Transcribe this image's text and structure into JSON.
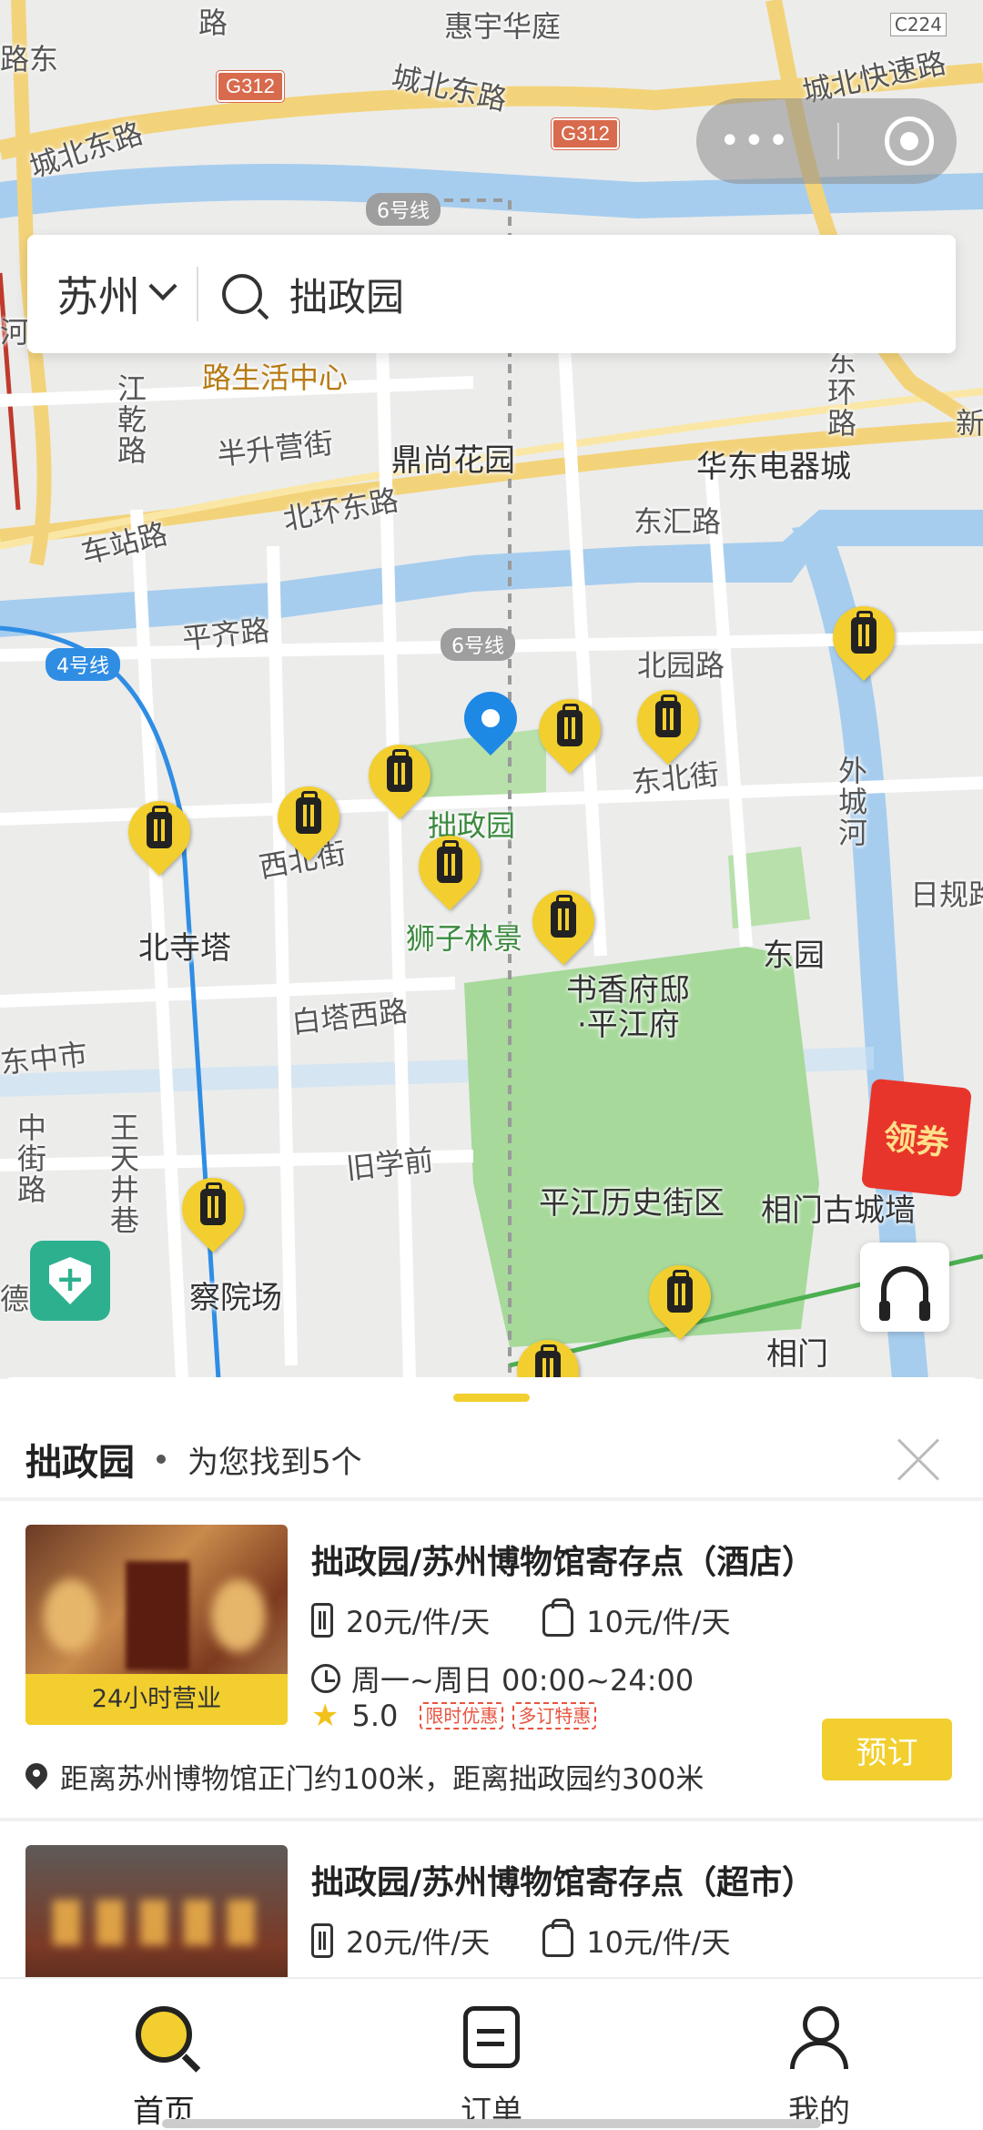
{
  "status_bar": {
    "carrier": "C224"
  },
  "search": {
    "city": "苏州",
    "query": "拙政园"
  },
  "map": {
    "labels": {
      "huiyu": "惠宇华庭",
      "chengbei_dong_1": "城北东路",
      "chengbei_dong_2": "城北东路",
      "chengbei_kuaisu": "城北快速路",
      "lu_shenghuo": "路生活中心",
      "banyuejie": "半升营街",
      "dingshang": "鼎尚花园",
      "beihuandong": "北环东路",
      "huadong": "华东电器城",
      "dongjin": "东汇路",
      "chezhan": "车站路",
      "pingqi": "平齐路",
      "beiyuan": "北园路",
      "dongbei": "东北街",
      "zhuozhengyuan": "拙政园",
      "xibei": "西北街",
      "shizilin": "狮子林景",
      "shuxiang": "书香府邸",
      "pingjiangfu": "·平江府",
      "dongyuan": "东园",
      "waichenghe": "外城河",
      "rigui": "日规路",
      "beisita": "北寺塔",
      "baitaxi": "白塔西路",
      "dongzhongshi": "东中市",
      "zhongjie": "中街路",
      "wangtian": "王天井巷",
      "jiuxueqian": "旧学前",
      "pingjiang_lishi": "平江历史街区",
      "xiangmen_gucheng": "相门古城墙",
      "chayuanchang": "察院场",
      "xiangmen": "相门",
      "jiangqian": "江乾路",
      "xiangshi": "东环路",
      "de": "德",
      "dongtop": "路",
      "he": "河",
      "cheng_dong": "路东",
      "xin": "新"
    },
    "road_badges": {
      "g312_a": "G312",
      "g312_b": "G312"
    },
    "line_badges": {
      "line6_a": "6号线",
      "line6_b": "6号线",
      "line4": "4号线"
    }
  },
  "coupon": {
    "label": "领券"
  },
  "sheet": {
    "title": "拙政园",
    "count_text": "为您找到5个",
    "items": [
      {
        "title": "拙政园/苏州博物馆寄存点（酒店）",
        "price_luggage": "20元/件/天",
        "price_bag": "10元/件/天",
        "hours": "周一~周日 00:00~24:00",
        "rating": "5.0",
        "promos": [
          "限时优惠",
          "多订特惠"
        ],
        "badge": "24小时营业",
        "address": "距离苏州博物馆正门约100米，距离拙政园约300米",
        "book_label": "预订"
      },
      {
        "title": "拙政园/苏州博物馆寄存点（超市）",
        "price_luggage": "20元/件/天",
        "price_bag": "10元/件/天"
      }
    ]
  },
  "tabs": [
    {
      "label": "首页",
      "active": true
    },
    {
      "label": "订单",
      "active": false
    },
    {
      "label": "我的",
      "active": false
    }
  ],
  "colors": {
    "accent": "#f2cf2e",
    "map_water": "#a6cdee",
    "park": "#a6d99a",
    "location_pin": "#1e88e5"
  }
}
